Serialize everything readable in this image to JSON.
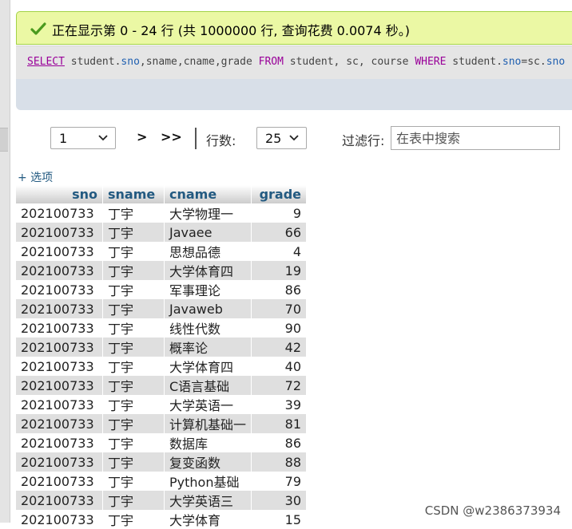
{
  "message": {
    "text": "正在显示第 0 - 24 行 (共 1000000 行, 查询花费 0.0074 秒。)",
    "color": "#ebf8a4",
    "border": "#a2d246"
  },
  "sql": {
    "select": "SELECT",
    "p1": " student.",
    "sno": "sno",
    "p2": ",sname,cname,grade ",
    "from": "FROM",
    "p3": " student, sc, course ",
    "where": "WHERE",
    "p4": " student.",
    "sno2": "sno",
    "p5": "=sc.",
    "sno3": "sno"
  },
  "nav": {
    "page_value": "1",
    "next": ">",
    "last": ">>",
    "rows_label": "行数:",
    "rows_value": "25",
    "filter_label": "过滤行:",
    "filter_placeholder": "在表中搜索"
  },
  "options_link": "+ 选项",
  "table": {
    "headers": [
      "sno",
      "sname",
      "cname",
      "grade"
    ],
    "rows": [
      [
        "202100733",
        "丁宇",
        "大学物理一",
        "9"
      ],
      [
        "202100733",
        "丁宇",
        "Javaee",
        "66"
      ],
      [
        "202100733",
        "丁宇",
        "思想品德",
        "4"
      ],
      [
        "202100733",
        "丁宇",
        "大学体育四",
        "19"
      ],
      [
        "202100733",
        "丁宇",
        "军事理论",
        "86"
      ],
      [
        "202100733",
        "丁宇",
        "Javaweb",
        "70"
      ],
      [
        "202100733",
        "丁宇",
        "线性代数",
        "90"
      ],
      [
        "202100733",
        "丁宇",
        "概率论",
        "42"
      ],
      [
        "202100733",
        "丁宇",
        "大学体育四",
        "40"
      ],
      [
        "202100733",
        "丁宇",
        "C语言基础",
        "72"
      ],
      [
        "202100733",
        "丁宇",
        "大学英语一",
        "39"
      ],
      [
        "202100733",
        "丁宇",
        "计算机基础一",
        "81"
      ],
      [
        "202100733",
        "丁宇",
        "数据库",
        "86"
      ],
      [
        "202100733",
        "丁宇",
        "复变函数",
        "88"
      ],
      [
        "202100733",
        "丁宇",
        "Python基础",
        "79"
      ],
      [
        "202100733",
        "丁宇",
        "大学英语三",
        "30"
      ],
      [
        "202100733",
        "丁宇",
        "大学体育",
        "15"
      ]
    ]
  },
  "watermark": "CSDN @w2386373934",
  "icons": {
    "success": "check-icon",
    "dropdown": "chevron-down-icon"
  },
  "colors": {
    "header_text": "#235a81",
    "row_alt": "#dfdfdf",
    "keyword": "#990099"
  }
}
